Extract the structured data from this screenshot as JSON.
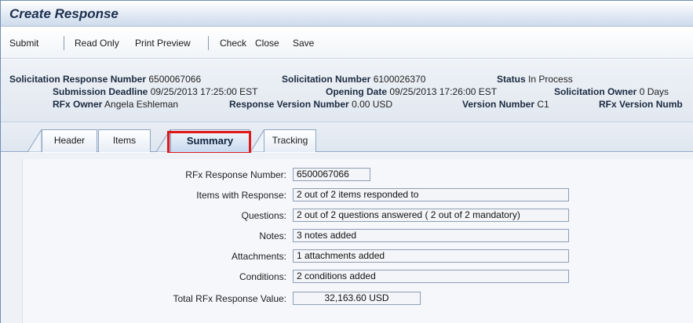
{
  "window": {
    "title": "Create Response"
  },
  "toolbar": {
    "submit": "Submit",
    "read_only": "Read Only",
    "print_preview": "Print Preview",
    "check": "Check",
    "close": "Close",
    "save": "Save"
  },
  "header": {
    "line1": {
      "srn_label": "Solicitation Response Number",
      "srn_value": "6500067066",
      "sn_label": "Solicitation Number",
      "sn_value": "6100026370",
      "status_label": "Status",
      "status_value": "In Process"
    },
    "line2": {
      "deadline_label": "Submission Deadline",
      "deadline_value": "09/25/2013 17:25:00 EST",
      "opening_label": "Opening Date",
      "opening_value": "09/25/2013 17:26:00 EST",
      "owner_label": "Solicitation Owner",
      "owner_value": "0 Days"
    },
    "line3": {
      "rfx_owner_label": "RFx Owner",
      "rfx_owner_value": "Angela Eshleman",
      "rvn_label": "Response Version Number",
      "rvn_value": "0.00 USD",
      "vn_label": "Version Number",
      "vn_value": "C1",
      "rfx_vn_label": "RFx Version Numb"
    }
  },
  "tabs": [
    {
      "label": "Header"
    },
    {
      "label": "Items"
    },
    {
      "label": "Summary",
      "active": true
    },
    {
      "label": "Tracking"
    }
  ],
  "summary": {
    "rfx_response_number": {
      "label": "RFx Response Number:",
      "value": "6500067066"
    },
    "items_with_response": {
      "label": "Items with Response:",
      "value": "2 out of 2 items responded to"
    },
    "questions": {
      "label": "Questions:",
      "value": "2 out of 2 questions answered ( 2 out of 2 mandatory)"
    },
    "notes": {
      "label": "Notes:",
      "value": "3 notes added"
    },
    "attachments": {
      "label": "Attachments:",
      "value": "1 attachments added"
    },
    "conditions": {
      "label": "Conditions:",
      "value": "2 conditions added"
    },
    "total_value": {
      "label": "Total RFx Response Value:",
      "value": "32,163.60 USD"
    }
  },
  "colors": {
    "highlight": "#e0191b",
    "title": "#1c2f4f"
  }
}
